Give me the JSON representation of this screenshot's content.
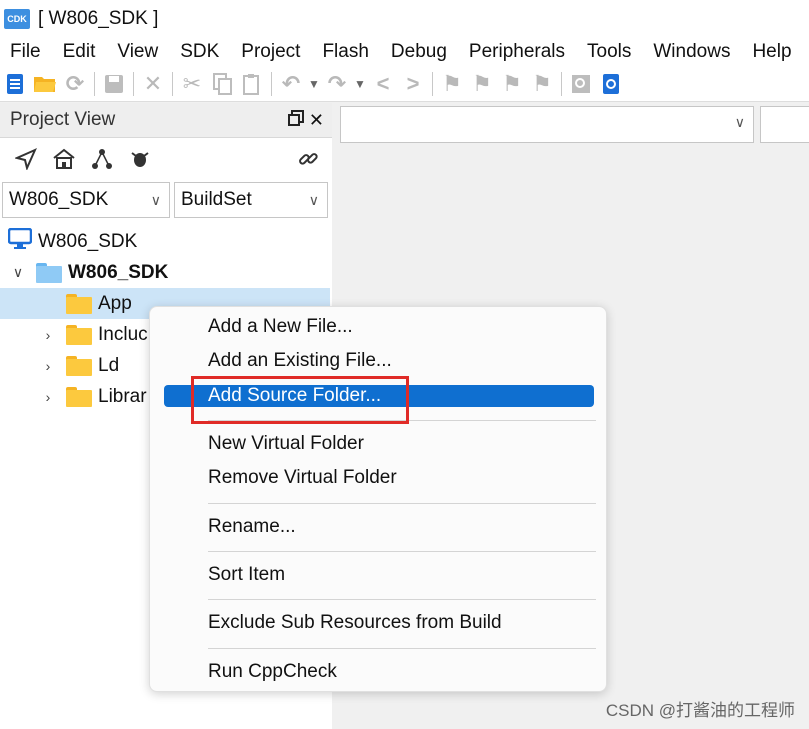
{
  "window": {
    "title": "[ W806_SDK ]",
    "logo_text": "CDK"
  },
  "menubar": [
    "File",
    "Edit",
    "View",
    "SDK",
    "Project",
    "Flash",
    "Debug",
    "Peripherals",
    "Tools",
    "Windows",
    "Help"
  ],
  "project_view": {
    "title": "Project View",
    "workspace_select": "W806_SDK",
    "build_select": "BuildSet",
    "tree": {
      "workspace": "W806_SDK",
      "project": "W806_SDK",
      "folders": [
        "App",
        "Incluc",
        "Ld",
        "Librar"
      ]
    }
  },
  "context_menu": {
    "items": [
      "Add a New File...",
      "Add an Existing File...",
      "Add Source Folder...",
      "New Virtual Folder",
      "Remove Virtual Folder",
      "Rename...",
      "Sort Item",
      "Exclude Sub Resources from Build",
      "Run CppCheck"
    ],
    "highlighted": "Add Source Folder..."
  },
  "watermark": "CSDN @打酱油的工程师",
  "colors": {
    "highlight": "#0f6fd0",
    "annotation_box": "#e02b27",
    "folder": "#fcc93e",
    "selected_row": "#cce4f7"
  }
}
